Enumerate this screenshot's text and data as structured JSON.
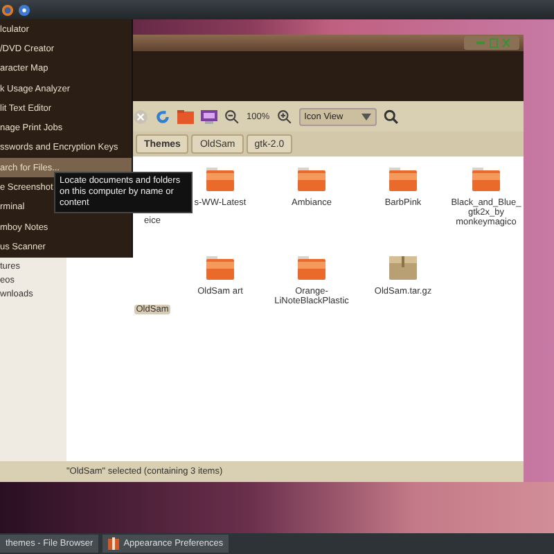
{
  "menu": {
    "items": [
      {
        "label": "lculator",
        "selected": false
      },
      {
        "label": "/DVD Creator",
        "selected": false
      },
      {
        "label": "aracter Map",
        "selected": false
      },
      {
        "label": "k Usage Analyzer",
        "selected": false
      },
      {
        "label": "lit Text Editor",
        "selected": false
      },
      {
        "label": "nage Print Jobs",
        "selected": false
      },
      {
        "label": "sswords and Encryption Keys",
        "selected": false
      },
      {
        "label": "arch for Files...",
        "selected": true
      },
      {
        "label": "e Screenshot",
        "selected": false
      },
      {
        "label": "rminal",
        "selected": false
      },
      {
        "label": "mboy Notes",
        "selected": false
      },
      {
        "label": "us Scanner",
        "selected": false
      }
    ]
  },
  "tooltip": "Locate documents and folders on this computer by name or content",
  "toolbar": {
    "zoom": "100%",
    "view": "Icon View"
  },
  "path_bar": [
    "Themes",
    "OldSam",
    "gtk-2.0"
  ],
  "sidebar": {
    "items": [
      "tures",
      "eos",
      "wnloads"
    ]
  },
  "files": [
    {
      "label": "eice",
      "kind": "covered",
      "selected": false
    },
    {
      "label": "s-WW-Latest",
      "kind": "folder",
      "selected": false
    },
    {
      "label": "Ambiance",
      "kind": "folder",
      "selected": false
    },
    {
      "label": "BarbPink",
      "kind": "folder",
      "selected": false
    },
    {
      "label": "Black_and_Blue_gtk2x_by monkeymagico",
      "kind": "folder",
      "selected": false
    },
    {
      "label": "OldSam",
      "kind": "covered",
      "selected": true
    },
    {
      "label": "OldSam art",
      "kind": "folder",
      "selected": false
    },
    {
      "label": "Orange-LiNoteBlackPlastic",
      "kind": "folder",
      "selected": false
    },
    {
      "label": "OldSam.tar.gz",
      "kind": "archive",
      "selected": false
    }
  ],
  "status_bar": "\"OldSam\" selected (containing 3 items)",
  "taskbar": [
    {
      "label": "themes - File Browser",
      "kind": "plain"
    },
    {
      "label": "Appearance Preferences",
      "kind": "app"
    }
  ]
}
